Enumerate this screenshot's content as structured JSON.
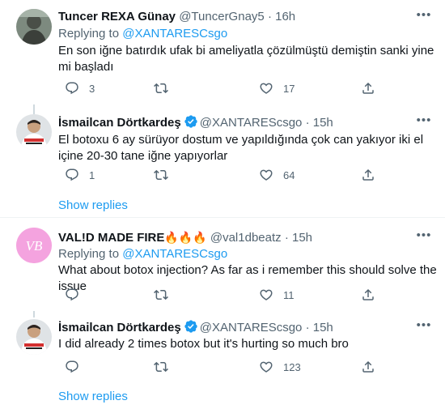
{
  "replying_label": "Replying to",
  "show_replies_label": "Show replies",
  "dot": "·",
  "tweets": [
    {
      "name": "Tuncer REXA Günay",
      "handle": "@TuncerGnay5",
      "time": "16h",
      "reply_to": "@XANTARESCsgo",
      "text": "En son iğne batırdık ufak bi ameliyatla çözülmüştü demiştin sanki yine mi başladı",
      "replies": "3",
      "retweets": "",
      "likes": "17",
      "verified": false
    },
    {
      "name": "İsmailcan Dörtkardeş",
      "handle": "@XANTAREScsgo",
      "time": "15h",
      "text": "El botoxu 6 ay sürüyor dostum ve yapıldığında çok can yakıyor iki el içine 20-30 tane iğne yapıyorlar",
      "replies": "1",
      "retweets": "",
      "likes": "64",
      "verified": true
    },
    {
      "name": "VAL!D MADE FIRE",
      "name_emoji": "🔥🔥🔥",
      "handle": "@val1dbeatz",
      "time": "15h",
      "reply_to": "@XANTARESCsgo",
      "text": "What about botox injection? As far as i remember this should solve the issue",
      "replies": "",
      "retweets": "",
      "likes": "11",
      "avatar_text": "VB",
      "verified": false
    },
    {
      "name": "İsmailcan Dörtkardeş",
      "handle": "@XANTAREScsgo",
      "time": "15h",
      "text": "I did already 2 times botox but it's hurting so much bro",
      "replies": "",
      "retweets": "",
      "likes": "123",
      "verified": true
    }
  ],
  "colors": {
    "accent": "#1d9bf0",
    "muted": "#536471",
    "text": "#0f1419",
    "divider": "#eff3f4",
    "avatar_pink": "#f7a8e0"
  },
  "icons": [
    "more-icon",
    "reply-icon",
    "retweet-icon",
    "like-icon",
    "share-icon",
    "verified-badge-icon"
  ]
}
